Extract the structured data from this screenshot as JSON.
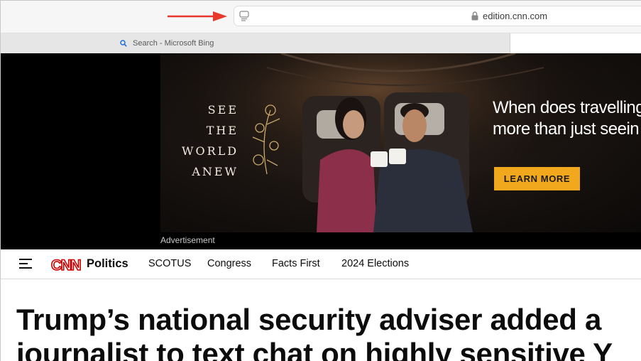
{
  "browser": {
    "url": "edition.cnn.com",
    "tab_label": "Search - Microsoft Bing",
    "icons": {
      "reader": "reader-view-icon",
      "lock": "lock-icon",
      "tab_search": "search-icon",
      "arrow": "red-arrow-pointer"
    },
    "arrow_color": "#e8382b"
  },
  "advertisement": {
    "tagline": [
      "SEE",
      "THE",
      "WORLD",
      "ANEW"
    ],
    "headline_line1": "When does travelling",
    "headline_line2": "more than just seein",
    "cta_label": "LEARN MORE",
    "caption": "Advertisement",
    "cta_color": "#f2a81d"
  },
  "nav": {
    "brand": "CNN",
    "section": "Politics",
    "links": [
      "SCOTUS",
      "Congress",
      "Facts First",
      "2024 Elections"
    ],
    "brand_color": "#cc0000"
  },
  "article": {
    "headline_line1": "Trump’s national security adviser added a",
    "headline_line2": "journalist to text chat on highly sensitive Y"
  }
}
